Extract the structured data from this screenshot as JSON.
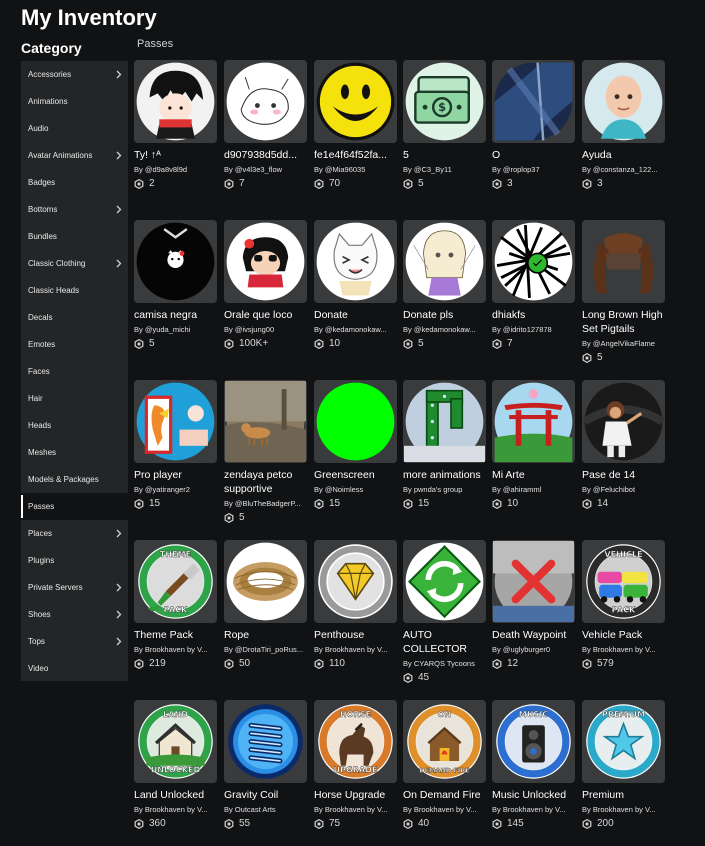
{
  "header": {
    "title": "My Inventory",
    "category_title": "Category",
    "section_label": "Passes"
  },
  "colors": {
    "background": "#111214",
    "sidebar": "#232527",
    "card": "#393b3d"
  },
  "sidebar": {
    "items": [
      {
        "label": "Accessories",
        "chevron": true
      },
      {
        "label": "Animations",
        "chevron": false
      },
      {
        "label": "Audio",
        "chevron": false
      },
      {
        "label": "Avatar Animations",
        "chevron": true
      },
      {
        "label": "Badges",
        "chevron": false
      },
      {
        "label": "Bottoms",
        "chevron": true
      },
      {
        "label": "Bundles",
        "chevron": false
      },
      {
        "label": "Classic Clothing",
        "chevron": true
      },
      {
        "label": "Classic Heads",
        "chevron": false
      },
      {
        "label": "Decals",
        "chevron": false
      },
      {
        "label": "Emotes",
        "chevron": false
      },
      {
        "label": "Faces",
        "chevron": false
      },
      {
        "label": "Hair",
        "chevron": false
      },
      {
        "label": "Heads",
        "chevron": false
      },
      {
        "label": "Meshes",
        "chevron": false
      },
      {
        "label": "Models & Packages",
        "chevron": false
      },
      {
        "label": "Passes",
        "chevron": false,
        "active": true
      },
      {
        "label": "Places",
        "chevron": true
      },
      {
        "label": "Plugins",
        "chevron": false
      },
      {
        "label": "Private Servers",
        "chevron": true
      },
      {
        "label": "Shoes",
        "chevron": true
      },
      {
        "label": "Tops",
        "chevron": true
      },
      {
        "label": "Video",
        "chevron": false
      }
    ]
  },
  "items": [
    {
      "name": "Ty! ↑ᴬ",
      "creator": "By @d9a8v8l9d",
      "count": "2",
      "icon": "anime-boy-icon"
    },
    {
      "name": "d907938d5dd...",
      "creator": "By @v4l3e3_flow",
      "count": "7",
      "icon": "sketch-drawing-icon"
    },
    {
      "name": "fe1e4f64f52fa...",
      "creator": "By @Mia96035",
      "count": "70",
      "icon": "smiley-face-icon"
    },
    {
      "name": "5",
      "creator": "By @C3_By11",
      "count": "5",
      "icon": "money-stack-icon"
    },
    {
      "name": "O",
      "creator": "By @roplop37",
      "count": "3",
      "icon": "blue-abstract-icon"
    },
    {
      "name": "Ayuda",
      "creator": "By @constanza_122...",
      "count": "3",
      "icon": "bald-avatar-icon"
    },
    {
      "name": "camisa negra",
      "creator": "By @yuda_michi",
      "count": "5",
      "icon": "black-shirt-icon"
    },
    {
      "name": "Orale que loco",
      "creator": "By @ivsjung00",
      "count": "100K+",
      "icon": "cartoon-girl-icon"
    },
    {
      "name": "Donate",
      "creator": "By @kedamonokaw...",
      "count": "10",
      "icon": "cat-meme-icon"
    },
    {
      "name": "Donate pls",
      "creator": "By @kedamonokaw...",
      "count": "5",
      "icon": "anime-sketch-icon"
    },
    {
      "name": "dhiakfs",
      "creator": "By @idrito127878",
      "count": "7",
      "icon": "scribble-icon"
    },
    {
      "name": "Long Brown High Set Pigtails",
      "creator": "By @AngelVikaFlame",
      "count": "5",
      "icon": "pigtails-hair-icon"
    },
    {
      "name": "Pro player",
      "creator": "By @yatiranger2",
      "count": "15",
      "icon": "dragon-icon"
    },
    {
      "name": "zendaya petco supportive",
      "creator": "By @BluTheBadgerP...",
      "count": "5",
      "icon": "dog-photo-icon"
    },
    {
      "name": "Greenscreen",
      "creator": "By @Noimless",
      "count": "15",
      "icon": "green-circle-icon"
    },
    {
      "name": "more animations",
      "creator": "By pwnda's group",
      "count": "15",
      "icon": "green-portal-icon"
    },
    {
      "name": "Mi Arte",
      "creator": "By @ahiramml",
      "count": "10",
      "icon": "torii-gate-icon"
    },
    {
      "name": "Pase de 14",
      "creator": "By @Feluchibot",
      "count": "14",
      "icon": "avatar-pose-icon"
    },
    {
      "name": "Theme Pack",
      "creator": "By Brookhaven by V...",
      "count": "219",
      "icon": "paint-brush-icon"
    },
    {
      "name": "Rope",
      "creator": "By @DrotaTiri_poRus...",
      "count": "50",
      "icon": "rope-icon"
    },
    {
      "name": "Penthouse",
      "creator": "By Brookhaven by V...",
      "count": "110",
      "icon": "diamond-icon"
    },
    {
      "name": "AUTO COLLECTOR",
      "creator": "By CYARQS Tycoons",
      "count": "45",
      "icon": "recycle-icon"
    },
    {
      "name": "Death Waypoint",
      "creator": "By @uglyburger0",
      "count": "12",
      "icon": "red-x-icon"
    },
    {
      "name": "Vehicle Pack",
      "creator": "By Brookhaven by V...",
      "count": "579",
      "icon": "cars-icon"
    },
    {
      "name": "Land Unlocked",
      "creator": "By Brookhaven by V...",
      "count": "360",
      "icon": "house-icon"
    },
    {
      "name": "Gravity Coil",
      "creator": "By Outcast Arts",
      "count": "55",
      "icon": "coil-icon"
    },
    {
      "name": "Horse Upgrade",
      "creator": "By Brookhaven by V...",
      "count": "75",
      "icon": "horse-icon"
    },
    {
      "name": "On Demand Fire",
      "creator": "By Brookhaven by V...",
      "count": "40",
      "icon": "fire-house-icon"
    },
    {
      "name": "Music Unlocked",
      "creator": "By Brookhaven by V...",
      "count": "145",
      "icon": "speaker-icon"
    },
    {
      "name": "Premium",
      "creator": "By Brookhaven by V...",
      "count": "200",
      "icon": "star-icon"
    }
  ],
  "badge_text": {
    "theme": [
      "THEME",
      "PACK"
    ],
    "vehicle": [
      "VEHICLE",
      "PACK"
    ],
    "land": [
      "LAND",
      "UNLOCKED"
    ],
    "horse": [
      "HORSE",
      "UPGRADE"
    ],
    "fire": [
      "ON",
      "DEMAND FIRE"
    ],
    "music": [
      "MUSIC"
    ],
    "premium": [
      "PREMIUM"
    ]
  }
}
